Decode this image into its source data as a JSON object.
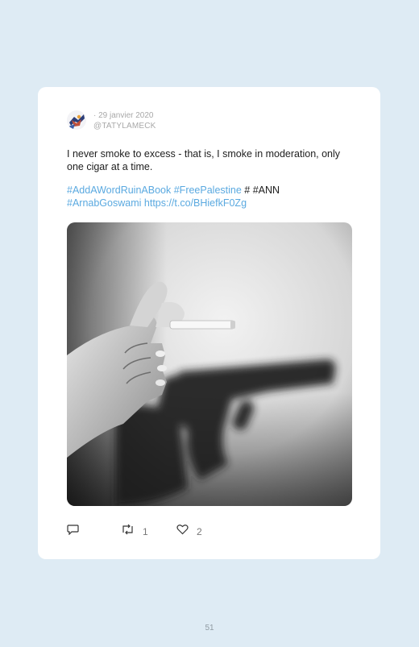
{
  "tweet": {
    "date": "· 29 janvier 2020",
    "handle": "@TATYLAMECK",
    "text": "I never smoke to excess - that is, I smoke in moderation, only one cigar at a time.",
    "hashtag_1": "#AddAWordRuinABook",
    "hashtag_2": "#FreePalestine",
    "plain_tags": " # #ANN",
    "hashtag_3": "#ArnabGoswami",
    "link": "https://t.co/BHiefkF0Zg",
    "retweets": "1",
    "likes": "2"
  },
  "icons": [
    "reply-icon",
    "retweet-icon",
    "heart-icon"
  ],
  "colors": {
    "background": "#deebf4",
    "card": "#ffffff",
    "link": "#5aa9e0"
  },
  "page_number": "51"
}
